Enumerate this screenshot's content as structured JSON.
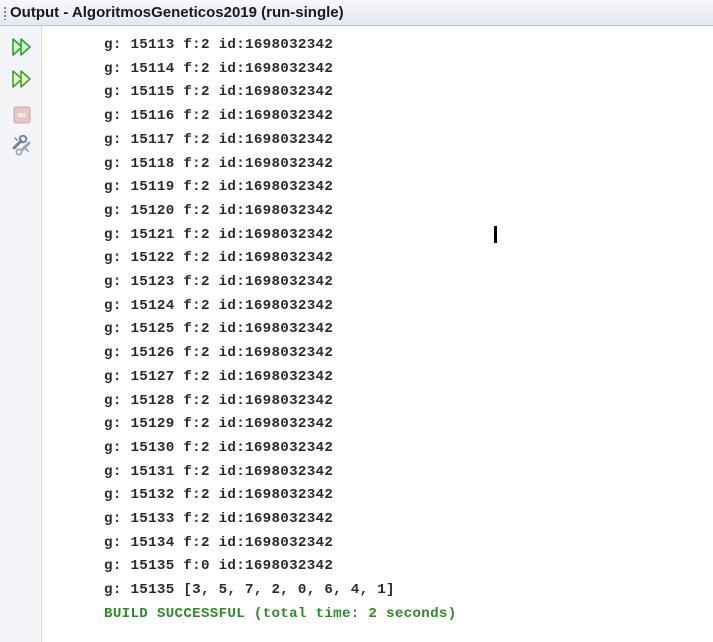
{
  "window": {
    "title": "Output - AlgoritmosGeneticos2019 (run-single)"
  },
  "toolbar": {
    "buttons": [
      {
        "name": "rerun",
        "icon": "double-play-icon",
        "color": "#2ea02e",
        "enabled": true
      },
      {
        "name": "rerun-with-different-parameters",
        "icon": "double-play-icon",
        "color": "#2ea02e",
        "enabled": true
      },
      {
        "name": "stop",
        "icon": "stop-icon",
        "color": "#d7a0a0",
        "enabled": false
      },
      {
        "name": "settings",
        "icon": "wrench-icon",
        "color": "#7a8a9a",
        "enabled": true
      }
    ]
  },
  "output": {
    "lines": [
      "g: 15113 f:2 id:1698032342",
      "g: 15114 f:2 id:1698032342",
      "g: 15115 f:2 id:1698032342",
      "g: 15116 f:2 id:1698032342",
      "g: 15117 f:2 id:1698032342",
      "g: 15118 f:2 id:1698032342",
      "g: 15119 f:2 id:1698032342",
      "g: 15120 f:2 id:1698032342",
      "g: 15121 f:2 id:1698032342",
      "g: 15122 f:2 id:1698032342",
      "g: 15123 f:2 id:1698032342",
      "g: 15124 f:2 id:1698032342",
      "g: 15125 f:2 id:1698032342",
      "g: 15126 f:2 id:1698032342",
      "g: 15127 f:2 id:1698032342",
      "g: 15128 f:2 id:1698032342",
      "g: 15129 f:2 id:1698032342",
      "g: 15130 f:2 id:1698032342",
      "g: 15131 f:2 id:1698032342",
      "g: 15132 f:2 id:1698032342",
      "g: 15133 f:2 id:1698032342",
      "g: 15134 f:2 id:1698032342",
      "g: 15135 f:0 id:1698032342",
      "g: 15135 [3, 5, 7, 2, 0, 6, 4, 1]"
    ],
    "status_line": "BUILD SUCCESSFUL (total time: 2 seconds)",
    "text_color": "#2a2a2a",
    "success_color": "#2f8a2a"
  }
}
